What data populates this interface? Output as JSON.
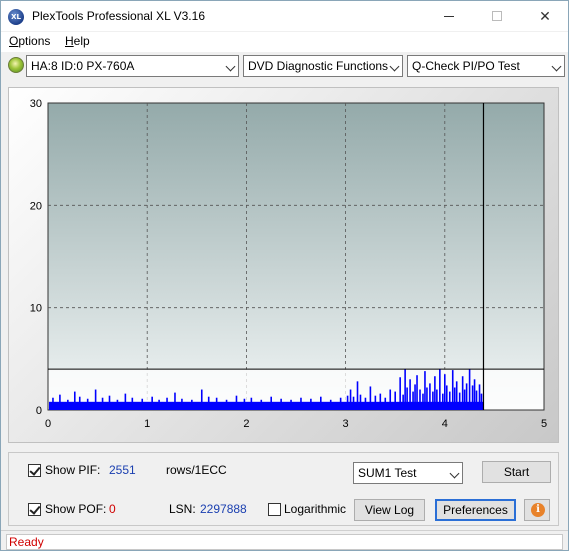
{
  "window": {
    "title": "PlexTools Professional XL V3.16",
    "app_icon": "XL",
    "close_glyph": "✕"
  },
  "menu": {
    "options_label": "Options",
    "options_accel": "O",
    "help_label": "Help",
    "help_accel": "H"
  },
  "toolbar": {
    "drive_select": "HA:8 ID:0  PX-760A",
    "function_select": "DVD Diagnostic Functions",
    "test_select": "Q-Check PI/PO Test"
  },
  "chart_data": {
    "type": "bar",
    "xlabel": "",
    "ylabel": "",
    "xlim": [
      0,
      5
    ],
    "ylim": [
      0,
      30
    ],
    "x_ticks": [
      "0",
      "1",
      "2",
      "3",
      "4",
      "5"
    ],
    "y_ticks": [
      "0",
      "10",
      "20",
      "30"
    ],
    "grid": true,
    "threshold_line": 4,
    "end_marker_x": 4.39,
    "series": [
      {
        "color": "#0000ff",
        "baseline": 0.8,
        "x": [
          0.05,
          0.12,
          0.2,
          0.27,
          0.32,
          0.4,
          0.48,
          0.55,
          0.62,
          0.7,
          0.78,
          0.85,
          0.95,
          1.05,
          1.12,
          1.2,
          1.28,
          1.35,
          1.45,
          1.55,
          1.62,
          1.7,
          1.8,
          1.9,
          1.98,
          2.05,
          2.15,
          2.25,
          2.35,
          2.45,
          2.55,
          2.65,
          2.75,
          2.85,
          2.95,
          3.02,
          3.05,
          3.08,
          3.12,
          3.15,
          3.2,
          3.25,
          3.3,
          3.35,
          3.4,
          3.45,
          3.5,
          3.55,
          3.58,
          3.6,
          3.62,
          3.65,
          3.68,
          3.7,
          3.72,
          3.75,
          3.78,
          3.8,
          3.82,
          3.85,
          3.88,
          3.9,
          3.92,
          3.95,
          3.98,
          4.0,
          4.02,
          4.05,
          4.08,
          4.1,
          4.12,
          4.15,
          4.18,
          4.2,
          4.22,
          4.25,
          4.28,
          4.3,
          4.32,
          4.35,
          4.37
        ],
        "values": [
          1.2,
          1.5,
          1.0,
          1.8,
          1.3,
          1.1,
          2.0,
          1.2,
          1.4,
          1.0,
          1.6,
          1.2,
          1.1,
          1.3,
          1.0,
          1.2,
          1.7,
          1.1,
          1.0,
          2.0,
          1.3,
          1.2,
          1.0,
          1.4,
          1.1,
          1.2,
          1.0,
          1.3,
          1.1,
          1.0,
          1.2,
          1.1,
          1.3,
          1.0,
          1.2,
          1.4,
          2.0,
          1.3,
          2.8,
          1.5,
          1.2,
          2.3,
          1.4,
          1.6,
          1.2,
          2.0,
          1.8,
          3.2,
          1.5,
          4.0,
          2.2,
          3.0,
          1.8,
          2.5,
          3.4,
          2.0,
          1.6,
          3.8,
          2.2,
          2.6,
          1.8,
          3.3,
          2.0,
          4.0,
          1.6,
          3.5,
          2.4,
          1.8,
          3.9,
          2.2,
          2.8,
          1.7,
          3.3,
          2.0,
          2.6,
          4.0,
          2.4,
          3.0,
          1.9,
          2.5,
          1.6
        ]
      }
    ]
  },
  "controls": {
    "show_pif_label": "Show PIF:",
    "show_pif_checked": true,
    "pif_value": "2551",
    "rows_label": "rows/1ECC",
    "show_pof_label": "Show POF:",
    "show_pof_checked": true,
    "pof_value": "0",
    "lsn_label": "LSN:",
    "lsn_value": "2297888",
    "logarithmic_label": "Logarithmic",
    "logarithmic_checked": false,
    "sum_select": "SUM1 Test",
    "start_label": "Start",
    "view_log_label": "View Log",
    "preferences_label": "Preferences",
    "info_icon": "i"
  },
  "status": {
    "text": "Ready"
  }
}
